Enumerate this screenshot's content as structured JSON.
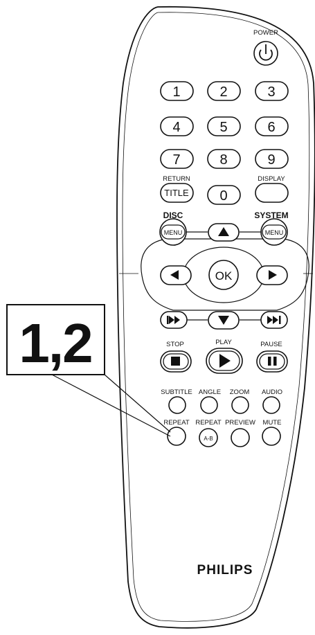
{
  "remote": {
    "power_label": "POWER",
    "digits": [
      "1",
      "2",
      "3",
      "4",
      "5",
      "6",
      "7",
      "8",
      "9",
      "0"
    ],
    "return_label": "RETURN",
    "title_key": "TITLE",
    "display_label": "DISPLAY",
    "disc_label": "DISC",
    "system_label": "SYSTEM",
    "menu_key": "MENU",
    "ok_key": "OK",
    "stop_label": "STOP",
    "play_label": "PLAY",
    "pause_label": "PAUSE",
    "row1_labels": [
      "SUBTITLE",
      "ANGLE",
      "ZOOM",
      "AUDIO"
    ],
    "row2_labels": [
      "REPEAT",
      "REPEAT",
      "PREVIEW",
      "MUTE"
    ],
    "ab_key": "A-B",
    "brand": "PHILIPS"
  },
  "callout": {
    "text": "1,2"
  }
}
